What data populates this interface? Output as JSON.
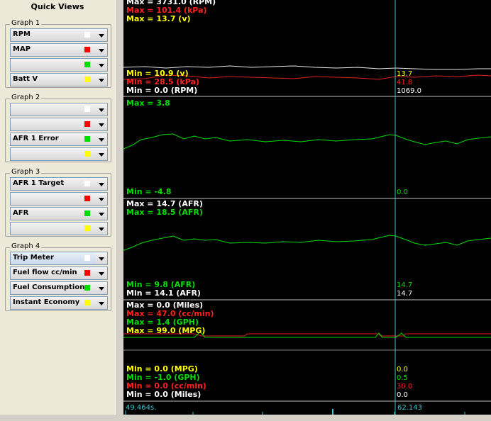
{
  "left_panel": {
    "title": "Quick Views",
    "groups": [
      {
        "label": "Graph 1",
        "rows": [
          {
            "label": "RPM",
            "color": "#ffffff"
          },
          {
            "label": "MAP",
            "color": "#ff0000"
          },
          {
            "label": "",
            "color": "#00dd00"
          },
          {
            "label": "Batt V",
            "color": "#ffff00"
          }
        ]
      },
      {
        "label": "Graph 2",
        "rows": [
          {
            "label": "",
            "color": "#ffffff"
          },
          {
            "label": "",
            "color": "#ff0000"
          },
          {
            "label": "AFR 1 Error",
            "color": "#00dd00"
          },
          {
            "label": "",
            "color": "#ffff00"
          }
        ]
      },
      {
        "label": "Graph 3",
        "rows": [
          {
            "label": "AFR 1 Target",
            "color": "#ffffff"
          },
          {
            "label": "",
            "color": "#ff0000"
          },
          {
            "label": "AFR",
            "color": "#00dd00"
          },
          {
            "label": "",
            "color": "#ffff00"
          }
        ]
      },
      {
        "label": "Graph 4",
        "rows": [
          {
            "label": "Trip Meter",
            "color": "#ffffff"
          },
          {
            "label": "Fuel flow cc/min",
            "color": "#ff0000"
          },
          {
            "label": "Fuel Consumption",
            "color": "#00dd00"
          },
          {
            "label": "Instant Economy",
            "color": "#ffff00"
          }
        ]
      }
    ]
  },
  "graphs": {
    "g1": {
      "max": [
        {
          "text": "Max = 3731.0 (RPM)",
          "color": "#ffffff"
        },
        {
          "text": "Max = 101.4 (kPa)",
          "color": "#ff2020"
        },
        {
          "text": "Max = 13.7 (v)",
          "color": "#ffff00"
        }
      ],
      "min": [
        {
          "text": "Min = 10.9 (v)",
          "color": "#ffff00"
        },
        {
          "text": "Min = 28.5 (kPa)",
          "color": "#ff2020"
        },
        {
          "text": "Min = 0.0 (RPM)",
          "color": "#ffffff"
        }
      ],
      "cursor_values": [
        {
          "text": "13.7",
          "color": "#ffff00"
        },
        {
          "text": "41.8",
          "color": "#ff2020"
        },
        {
          "text": "1069.0",
          "color": "#ffffff"
        }
      ]
    },
    "g2": {
      "max": [
        {
          "text": "Max = 3.8",
          "color": "#00dd00"
        }
      ],
      "min": [
        {
          "text": "Min = -4.8",
          "color": "#00dd00"
        }
      ],
      "cursor_values": [
        {
          "text": "0.0",
          "color": "#00dd00"
        }
      ]
    },
    "g3": {
      "max": [
        {
          "text": "Max = 14.7 (AFR)",
          "color": "#ffffff"
        },
        {
          "text": "Max = 18.5 (AFR)",
          "color": "#00dd00"
        }
      ],
      "min": [
        {
          "text": "Min = 9.8 (AFR)",
          "color": "#00dd00"
        },
        {
          "text": "Min = 14.1 (AFR)",
          "color": "#ffffff"
        }
      ],
      "cursor_values": [
        {
          "text": "14.7",
          "color": "#00dd00"
        },
        {
          "text": "14.7",
          "color": "#ffffff"
        }
      ]
    },
    "g4": {
      "max": [
        {
          "text": "Max = 0.0 (Miles)",
          "color": "#ffffff"
        },
        {
          "text": "Max = 47.0 (cc/min)",
          "color": "#ff2020"
        },
        {
          "text": "Max = 1.4 (GPH)",
          "color": "#00dd00"
        },
        {
          "text": "Max = 99.0 (MPG)",
          "color": "#ffff00"
        }
      ],
      "min": [
        {
          "text": "Min = 0.0 (MPG)",
          "color": "#ffff00"
        },
        {
          "text": "Min = -1.0 (GPH)",
          "color": "#00dd00"
        },
        {
          "text": "Min = 0.0 (cc/min)",
          "color": "#ff2020"
        },
        {
          "text": "Min = 0.0 (Miles)",
          "color": "#ffffff"
        }
      ],
      "cursor_values": [
        {
          "text": "0.0",
          "color": "#ffff00"
        },
        {
          "text": "0.5",
          "color": "#00dd00"
        },
        {
          "text": "30.0",
          "color": "#ff2020"
        },
        {
          "text": "0.0",
          "color": "#ffffff"
        }
      ]
    }
  },
  "timeline": {
    "start_time": "49.464s.",
    "cursor_time": "62.143"
  },
  "colors": {
    "cursor": "#40c0d0",
    "divider": "#c0c0c0"
  }
}
